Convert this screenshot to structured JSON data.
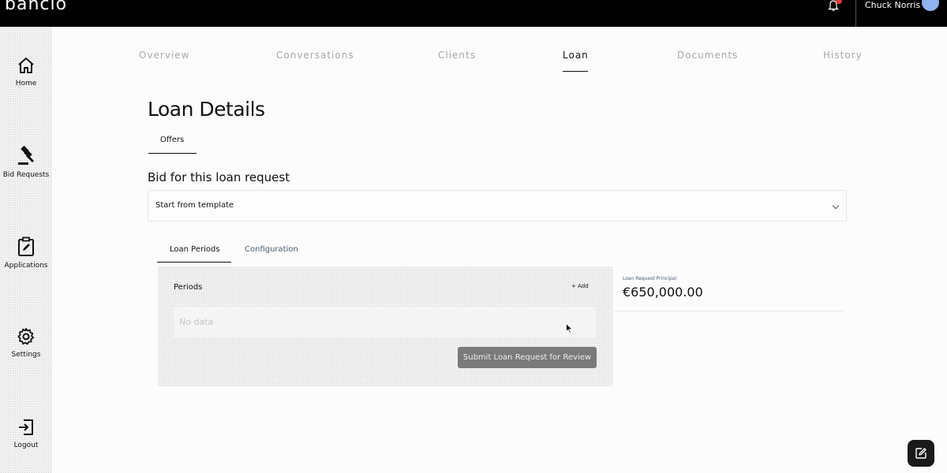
{
  "app": {
    "logo": "banclo"
  },
  "header": {
    "user_name": "Chuck Norris"
  },
  "sidebar": {
    "items": [
      {
        "label": "Home",
        "icon": "home-icon"
      },
      {
        "label": "Bid Requests",
        "icon": "gavel-icon"
      },
      {
        "label": "Applications",
        "icon": "clipboard-edit-icon"
      },
      {
        "label": "Settings",
        "icon": "gear-icon"
      },
      {
        "label": "Logout",
        "icon": "logout-icon"
      }
    ]
  },
  "nav": {
    "tabs": [
      {
        "label": "Overview",
        "active": false
      },
      {
        "label": "Conversations",
        "active": false
      },
      {
        "label": "Clients",
        "active": false
      },
      {
        "label": "Loan",
        "active": true
      },
      {
        "label": "Documents",
        "active": false
      },
      {
        "label": "History",
        "active": false
      }
    ]
  },
  "page": {
    "title": "Loan Details",
    "subtab": "Offers",
    "bid_title": "Bid for this loan request",
    "template_select": {
      "value": "Start from template"
    },
    "inner_tabs": [
      {
        "label": "Loan Periods",
        "active": true
      },
      {
        "label": "Configuration",
        "active": false
      }
    ],
    "periods": {
      "label": "Periods",
      "add_label": "+ Add",
      "empty_text": "No data",
      "submit_label": "Submit Loan Request for Review"
    },
    "principal": {
      "label": "Loan Request Principal",
      "value": "€650,000.00"
    }
  },
  "colors": {
    "topbar": "#000000",
    "notification_dot": "#e53935",
    "avatar": "#8fb4ee",
    "submit_button": "#7a7a7a",
    "muted_tab": "#a8a8a8",
    "slate_text": "#4a5b72"
  }
}
